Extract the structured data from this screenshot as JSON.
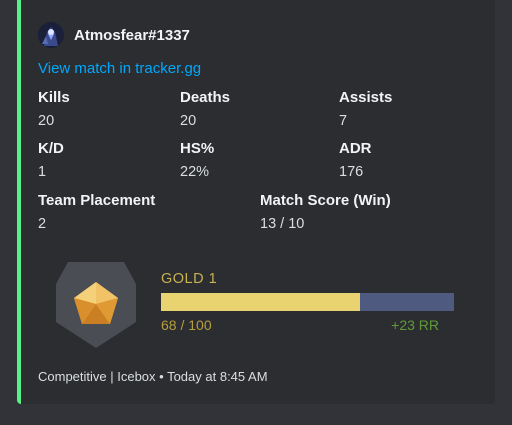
{
  "colors": {
    "accent_bar": "#57f287",
    "link": "#00a8fc",
    "rank_gold": "#c9b24f",
    "rr_gain": "#5e9b35",
    "bar_fill": "#e9d270",
    "bar_bg": "#4e5a80"
  },
  "author": {
    "name": "Atmosfear#1337",
    "avatar_icon": "agent-avatar-icon"
  },
  "link_text": "View match in tracker.gg",
  "fields": {
    "kills": {
      "name": "Kills",
      "value": "20"
    },
    "deaths": {
      "name": "Deaths",
      "value": "20"
    },
    "assists": {
      "name": "Assists",
      "value": "7"
    },
    "kd": {
      "name": "K/D",
      "value": "1"
    },
    "hs": {
      "name": "HS%",
      "value": "22%"
    },
    "adr": {
      "name": "ADR",
      "value": "176"
    },
    "placement": {
      "name": "Team Placement",
      "value": "2"
    },
    "score": {
      "name": "Match Score (Win)",
      "value": "13 / 10"
    }
  },
  "rank": {
    "icon": "gold-rank-icon",
    "name": "GOLD 1",
    "rr_text": "68 / 100",
    "rr_progress": 0.68,
    "rr_gain": "+23 RR"
  },
  "footer": "Competitive | Icebox • Today at 8:45 AM"
}
